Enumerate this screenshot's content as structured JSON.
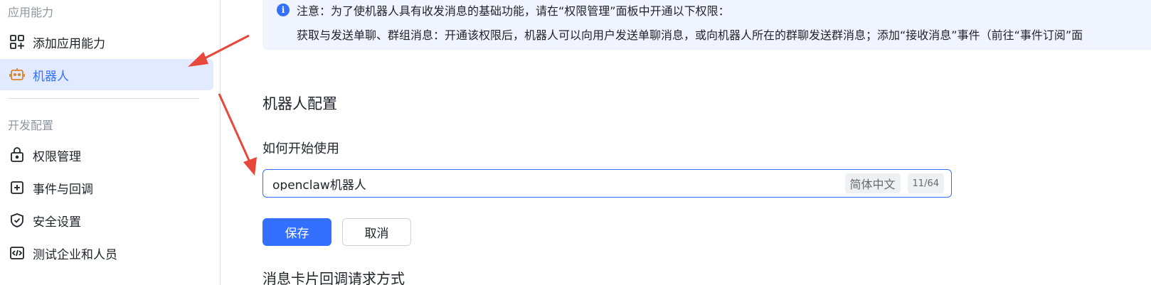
{
  "sidebar": {
    "section_app": "应用能力",
    "section_dev": "开发配置",
    "items": [
      {
        "label": "添加应用能力",
        "icon": "add-capability-icon"
      },
      {
        "label": "机器人",
        "icon": "robot-icon",
        "active": true
      },
      {
        "label": "权限管理",
        "icon": "lock-icon"
      },
      {
        "label": "事件与回调",
        "icon": "event-icon"
      },
      {
        "label": "安全设置",
        "icon": "shield-icon"
      },
      {
        "label": "测试企业和人员",
        "icon": "code-icon"
      }
    ]
  },
  "notice": {
    "line1": "注意：为了使机器人具有收发消息的基础功能，请在“权限管理”面板中开通以下权限：",
    "line2": "获取与发送单聊、群组消息：开通该权限后，机器人可以向用户发送单聊消息，或向机器人所在的群聊发送群消息；添加“接收消息”事件（前往“事件订阅”面"
  },
  "main": {
    "config_title": "机器人配置",
    "field_label": "如何开始使用",
    "input_value": "openclaw机器人",
    "lang_tag": "简体中文",
    "counter": "11/64",
    "save_label": "保存",
    "cancel_label": "取消",
    "next_section_title": "消息卡片回调请求方式"
  },
  "colors": {
    "accent": "#3370ff",
    "active_bg": "#e1eaff",
    "notice_bg": "#f0f4ff",
    "annotation_arrow": "#e8483b"
  }
}
